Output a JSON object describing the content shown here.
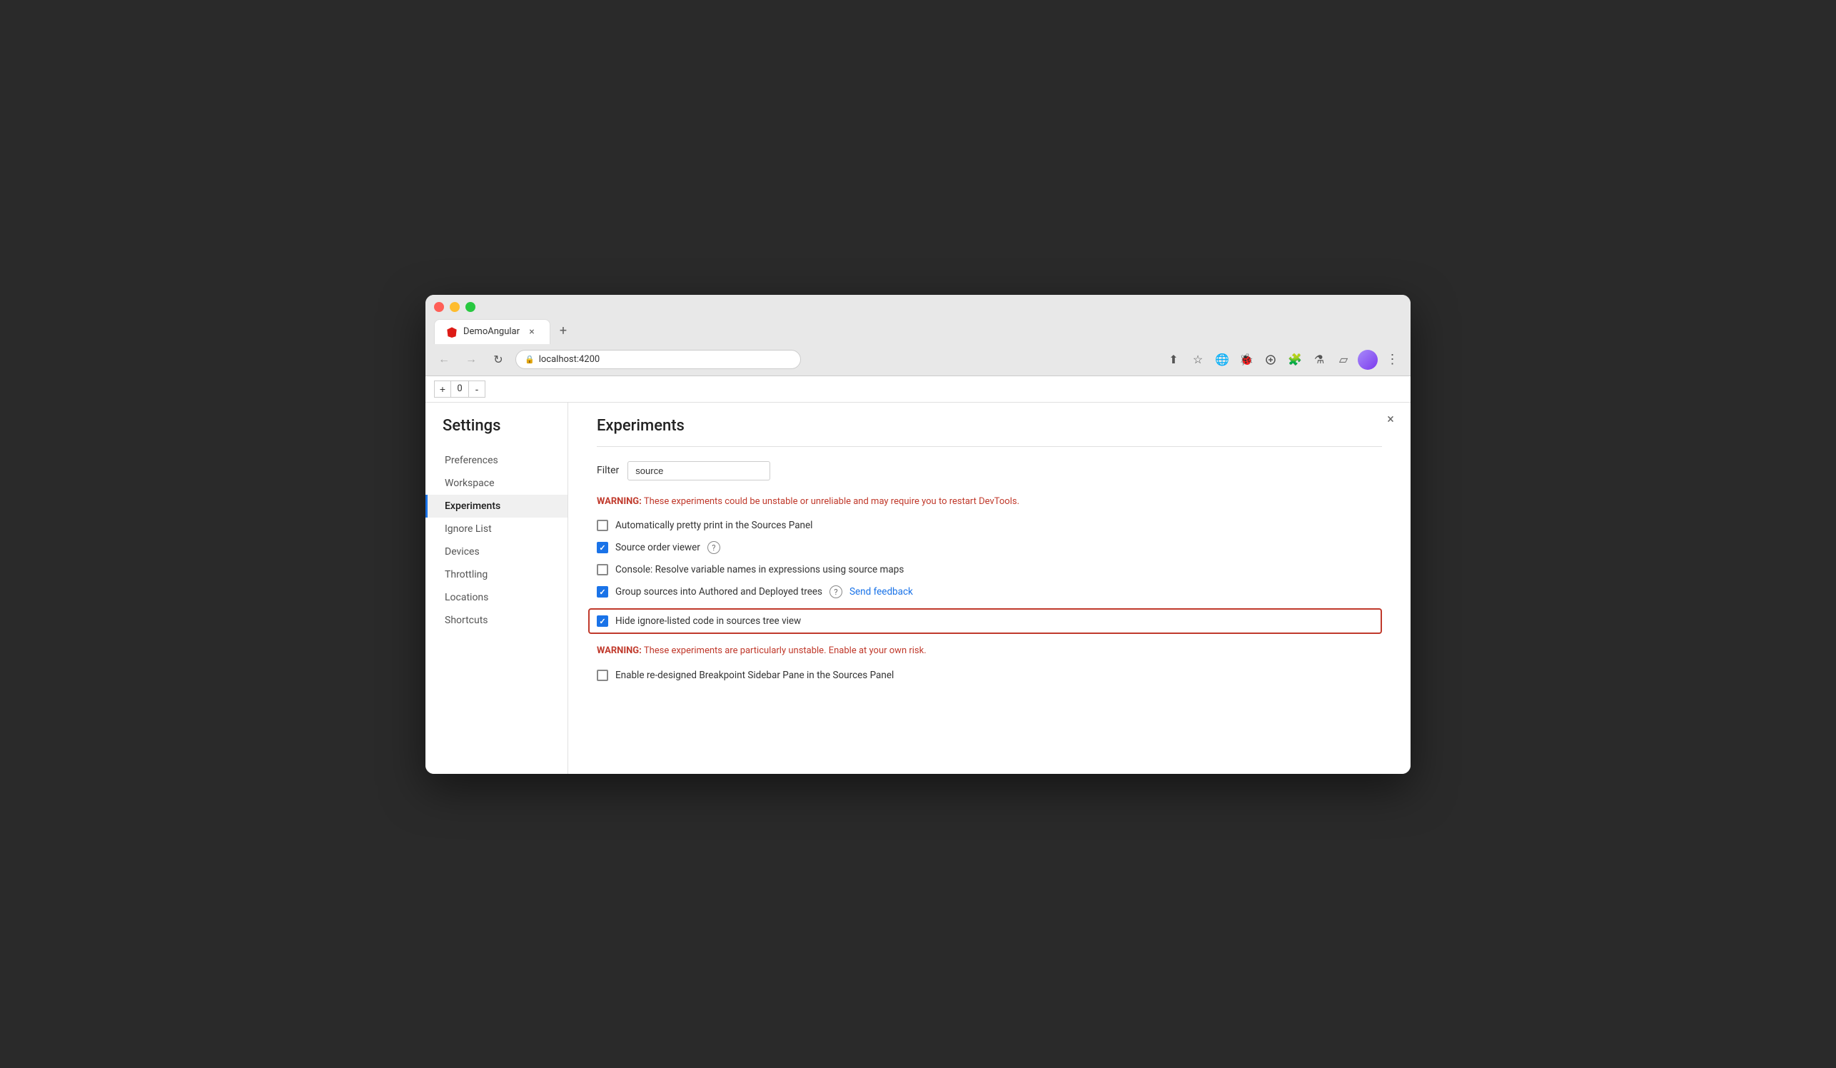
{
  "browser": {
    "tab_title": "DemoAngular",
    "tab_close": "×",
    "tab_new": "+",
    "url": "localhost:4200",
    "nav": {
      "back_label": "←",
      "forward_label": "→",
      "reload_label": "↻",
      "more_label": "⋮",
      "chevron_label": "⌄"
    },
    "toolbar": {
      "share": "⬆",
      "star": "☆",
      "earth": "🌐",
      "bug": "🐞",
      "ext1": "🎯",
      "puzzle": "🧩",
      "flask": "⚗",
      "sidebar": "▱"
    },
    "counter": {
      "plus": "+",
      "value": "0",
      "minus": "-"
    }
  },
  "settings": {
    "panel_title": "Settings",
    "close_btn": "×",
    "nav_items": [
      {
        "id": "preferences",
        "label": "Preferences",
        "active": false
      },
      {
        "id": "workspace",
        "label": "Workspace",
        "active": false
      },
      {
        "id": "experiments",
        "label": "Experiments",
        "active": true
      },
      {
        "id": "ignore-list",
        "label": "Ignore List",
        "active": false
      },
      {
        "id": "devices",
        "label": "Devices",
        "active": false
      },
      {
        "id": "throttling",
        "label": "Throttling",
        "active": false
      },
      {
        "id": "locations",
        "label": "Locations",
        "active": false
      },
      {
        "id": "shortcuts",
        "label": "Shortcuts",
        "active": false
      }
    ],
    "experiments": {
      "title": "Experiments",
      "filter_label": "Filter",
      "filter_value": "source",
      "filter_placeholder": "source",
      "warning1": {
        "prefix": "WARNING:",
        "text": " These experiments could be unstable or unreliable and may require you to restart DevTools."
      },
      "items": [
        {
          "id": "pretty-print",
          "label": "Automatically pretty print in the Sources Panel",
          "checked": false,
          "has_help": false,
          "has_feedback": false,
          "highlighted": false
        },
        {
          "id": "source-order-viewer",
          "label": "Source order viewer",
          "checked": true,
          "has_help": true,
          "has_feedback": false,
          "highlighted": false
        },
        {
          "id": "resolve-variables",
          "label": "Console: Resolve variable names in expressions using source maps",
          "checked": false,
          "has_help": false,
          "has_feedback": false,
          "highlighted": false
        },
        {
          "id": "group-sources",
          "label": "Group sources into Authored and Deployed trees",
          "checked": true,
          "has_help": true,
          "has_feedback": true,
          "feedback_label": "Send feedback",
          "highlighted": false
        },
        {
          "id": "hide-ignore-listed",
          "label": "Hide ignore-listed code in sources tree view",
          "checked": true,
          "has_help": false,
          "has_feedback": false,
          "highlighted": true
        }
      ],
      "warning2": {
        "prefix": "WARNING:",
        "text": " These experiments are particularly unstable. Enable at your own risk."
      },
      "unstable_items": [
        {
          "id": "redesigned-breakpoint",
          "label": "Enable re-designed Breakpoint Sidebar Pane in the Sources Panel",
          "checked": false,
          "has_help": false,
          "has_feedback": false,
          "highlighted": false
        }
      ]
    }
  }
}
